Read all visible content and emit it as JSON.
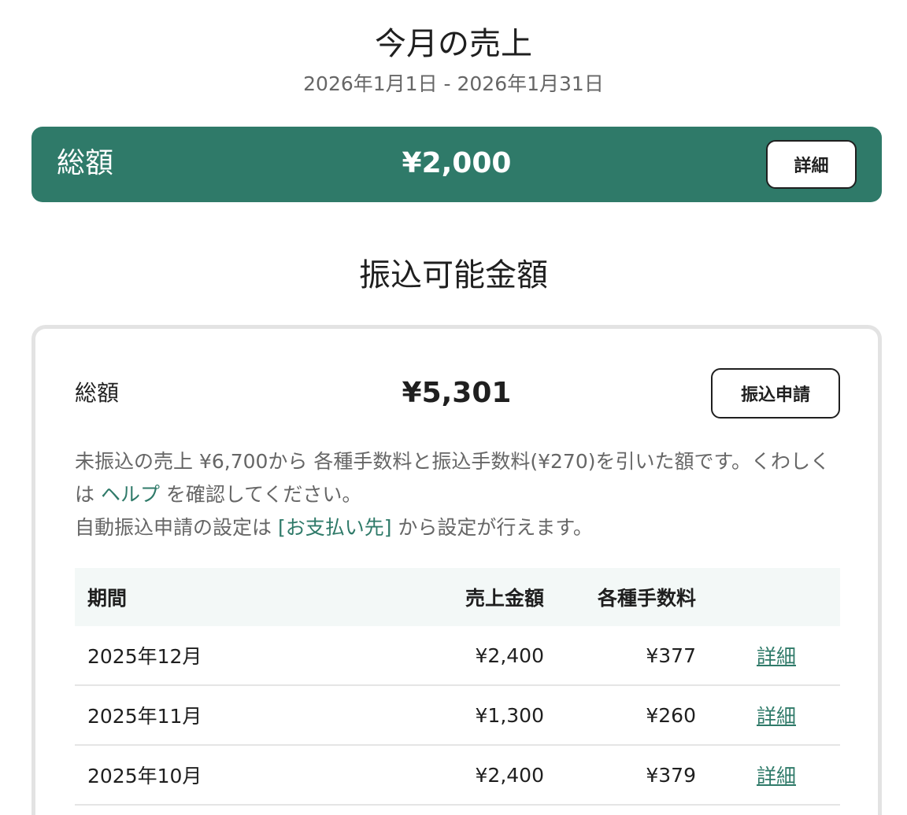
{
  "sales_month": {
    "title": "今月の売上",
    "range": "2026年1月1日 - 2026年1月31日",
    "total_label": "総額",
    "total_amount": "¥2,000",
    "detail_label": "詳細"
  },
  "transferable": {
    "title": "振込可能金額",
    "total_label": "総額",
    "total_amount": "¥5,301",
    "transfer_button": "振込申請",
    "desc_line1_a": "未振込の売上 ¥6,700から 各種手数料と振込手数料(¥270)を引いた額です。くわしくは ",
    "help_link": "ヘルプ",
    "desc_line1_b": " を確認してください。",
    "desc_line2_a": "自動振込申請の設定は ",
    "payee_link": "[お支払い先]",
    "desc_line2_b": " から設定が行えます。"
  },
  "table": {
    "headers": {
      "period": "期間",
      "sales": "売上金額",
      "fees": "各種手数料"
    },
    "rows": [
      {
        "period": "2025年12月",
        "sales": "¥2,400",
        "fees": "¥377",
        "detail": "詳細"
      },
      {
        "period": "2025年11月",
        "sales": "¥1,300",
        "fees": "¥260",
        "detail": "詳細"
      },
      {
        "period": "2025年10月",
        "sales": "¥2,400",
        "fees": "¥379",
        "detail": "詳細"
      }
    ]
  },
  "colors": {
    "accent": "#2f7a69",
    "muted_text": "#666666",
    "header_bg": "#f3f8f7"
  }
}
